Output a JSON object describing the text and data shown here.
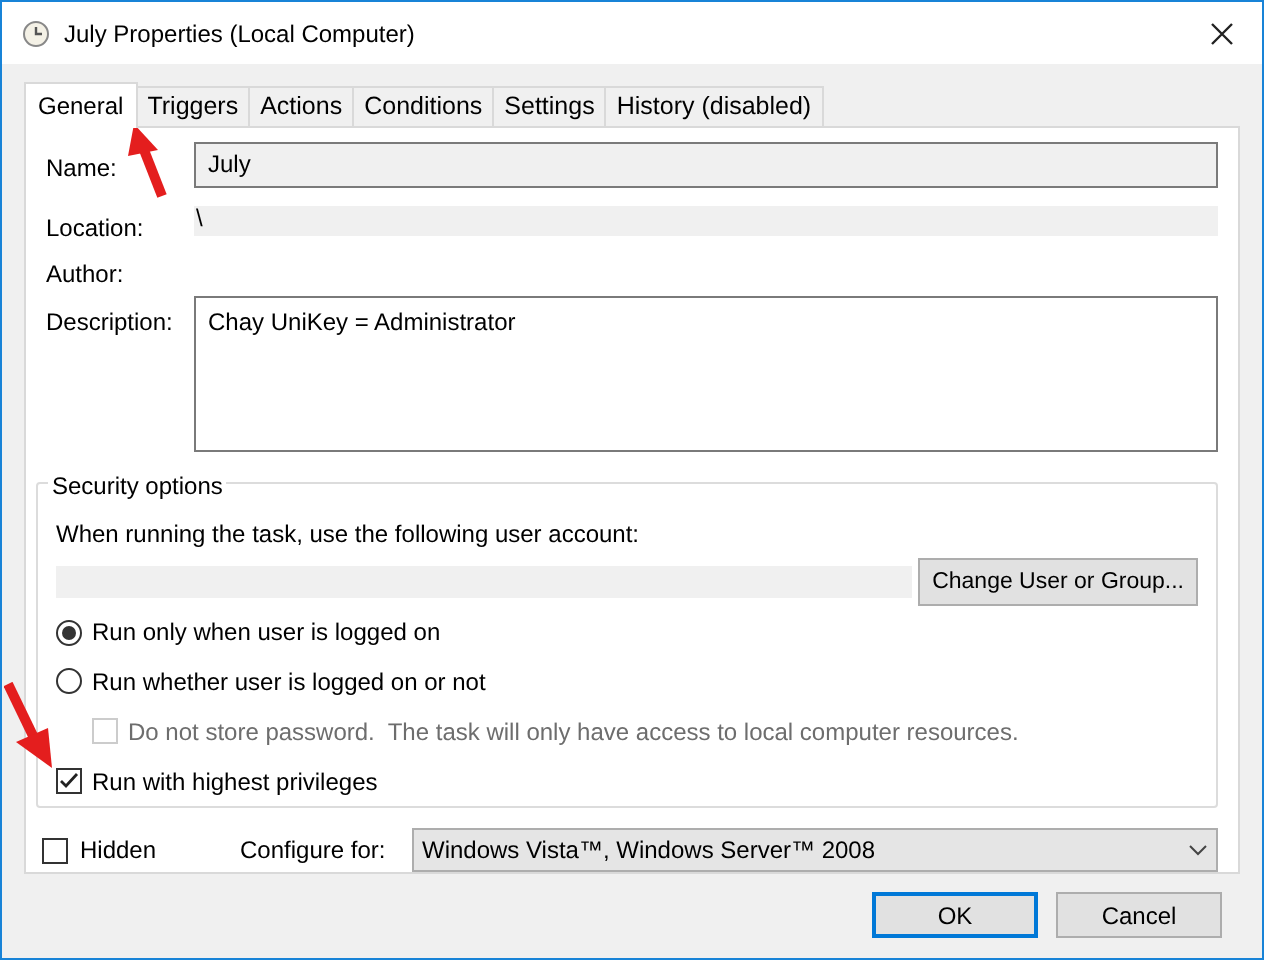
{
  "window": {
    "title": "July Properties (Local Computer)"
  },
  "tabs": [
    {
      "label": "General",
      "selected": true
    },
    {
      "label": "Triggers",
      "selected": false
    },
    {
      "label": "Actions",
      "selected": false
    },
    {
      "label": "Conditions",
      "selected": false
    },
    {
      "label": "Settings",
      "selected": false
    },
    {
      "label": "History (disabled)",
      "selected": false
    }
  ],
  "general": {
    "name": {
      "label": "Name:",
      "value": "July"
    },
    "location": {
      "label": "Location:",
      "value": "\\"
    },
    "author": {
      "label": "Author:"
    },
    "description": {
      "label": "Description:",
      "value": "Chay UniKey = Administrator"
    }
  },
  "security_options": {
    "title": "Security options",
    "account_prompt": "When running the task, use the following user account:",
    "change_button": "Change User or Group...",
    "options": [
      {
        "kind": "radio",
        "label": "Run only when user is logged on",
        "selected": true,
        "disabled": false
      },
      {
        "kind": "radio",
        "label": "Run whether user is logged on or not",
        "selected": false,
        "disabled": false,
        "children": [
          {
            "kind": "checkbox",
            "label": "Do not store password.  The task will only have access to local computer resources.",
            "checked": false,
            "disabled": true
          }
        ]
      },
      {
        "kind": "checkbox",
        "label": "Run with highest privileges",
        "checked": true,
        "disabled": false
      }
    ]
  },
  "hidden": {
    "label": "Hidden",
    "checked": false
  },
  "configure_for": {
    "label": "Configure for:",
    "value": "Windows Vista™, Windows Server™ 2008"
  },
  "buttons": [
    {
      "label": "OK",
      "default": true
    },
    {
      "label": "Cancel",
      "default": false
    }
  ]
}
